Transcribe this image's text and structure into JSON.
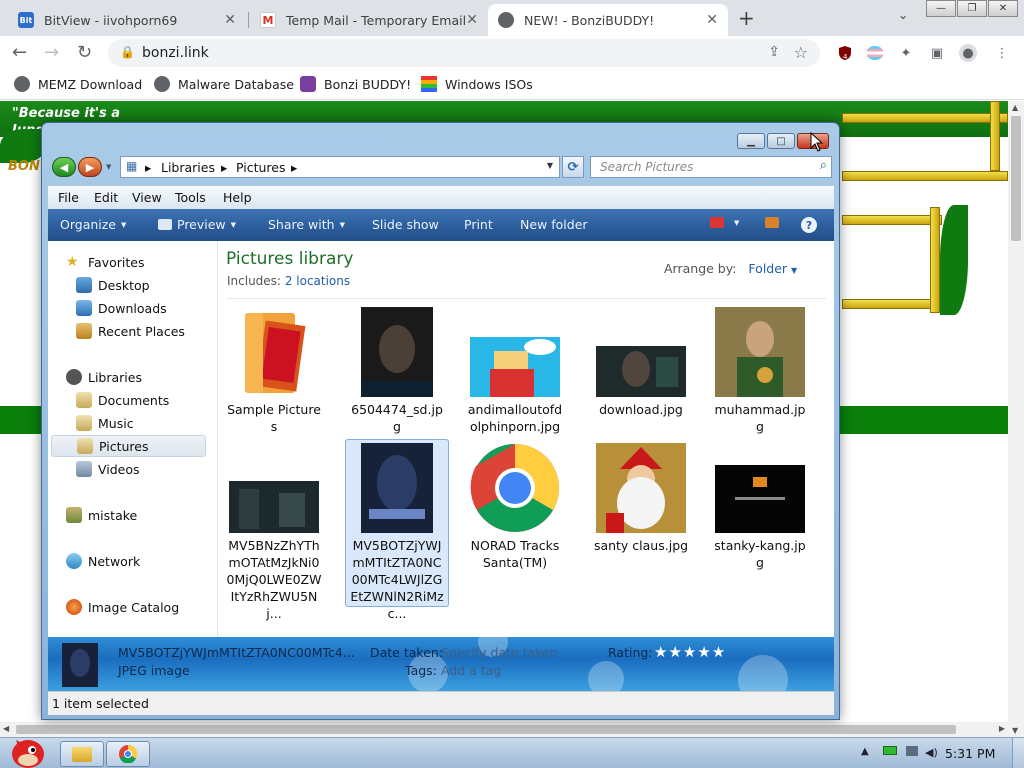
{
  "browser": {
    "tabs": [
      {
        "title": "BitView - iivohporn69",
        "icon": "bitview-icon",
        "active": false
      },
      {
        "title": "Temp Mail - Temporary Email",
        "icon": "gmail-icon",
        "active": false
      },
      {
        "title": "NEW! - BonziBUDDY!",
        "icon": "globe-icon",
        "active": true
      }
    ],
    "url": "bonzi.link",
    "bookmarks": [
      {
        "label": "MEMZ Download",
        "icon": "globe-icon"
      },
      {
        "label": "Malware Database",
        "icon": "globe-icon"
      },
      {
        "label": "Bonzi BUDDY!",
        "icon": "bonzi-icon"
      },
      {
        "label": "Windows ISOs",
        "icon": "windows-flag-icon"
      }
    ],
    "extension_badge": "4"
  },
  "webpage": {
    "banner_text_line1": "\"Because it's a",
    "banner_text_line2": "Jungle",
    "logo_fragment": "BON"
  },
  "explorer": {
    "breadcrumb": [
      "Libraries",
      "Pictures"
    ],
    "search_placeholder": "Search Pictures",
    "menu": [
      "File",
      "Edit",
      "View",
      "Tools",
      "Help"
    ],
    "commands": {
      "organize": "Organize",
      "preview": "Preview",
      "share_with": "Share with",
      "slide_show": "Slide show",
      "print": "Print",
      "new_folder": "New folder"
    },
    "nav": {
      "favorites": "Favorites",
      "desktop": "Desktop",
      "downloads": "Downloads",
      "recent": "Recent Places",
      "libraries": "Libraries",
      "documents": "Documents",
      "music": "Music",
      "pictures": "Pictures",
      "videos": "Videos",
      "mistake": "mistake",
      "network": "Network",
      "image_catalog": "Image Catalog"
    },
    "library": {
      "title": "Pictures library",
      "includes_label": "Includes:",
      "locations": "2 locations",
      "arrange_label": "Arrange by:",
      "arrange_value": "Folder"
    },
    "files": [
      {
        "name": "Sample Pictures"
      },
      {
        "name": "6504474_sd.jpg"
      },
      {
        "name": "andimalloutofdolphinporn.jpg"
      },
      {
        "name": "download.jpg"
      },
      {
        "name": "muhammad.jpg"
      },
      {
        "name": "MV5BNzZhYThmOTAtMzJkNi00MjQ0LWE0ZWItYzRhZWU5Nj..."
      },
      {
        "name": "MV5BOTZjYWJmMTItZTA0NC00MTc4LWJlZGEtZWNlN2RiMzc..."
      },
      {
        "name": "NORAD Tracks Santa(TM)"
      },
      {
        "name": "santy claus.jpg"
      },
      {
        "name": "stanky-kang.jpg"
      }
    ],
    "details": {
      "filename": "MV5BOTZjYWJmMTItZTA0NC00MTc4...",
      "filetype": "JPEG image",
      "date_label": "Date taken:",
      "date_value": "Specify date taken",
      "tags_label": "Tags:",
      "tags_value": "Add a tag",
      "rating_label": "Rating:",
      "rating_stars": "★★★★★"
    },
    "status": "1 item selected"
  },
  "taskbar": {
    "time": "5:31 PM"
  }
}
